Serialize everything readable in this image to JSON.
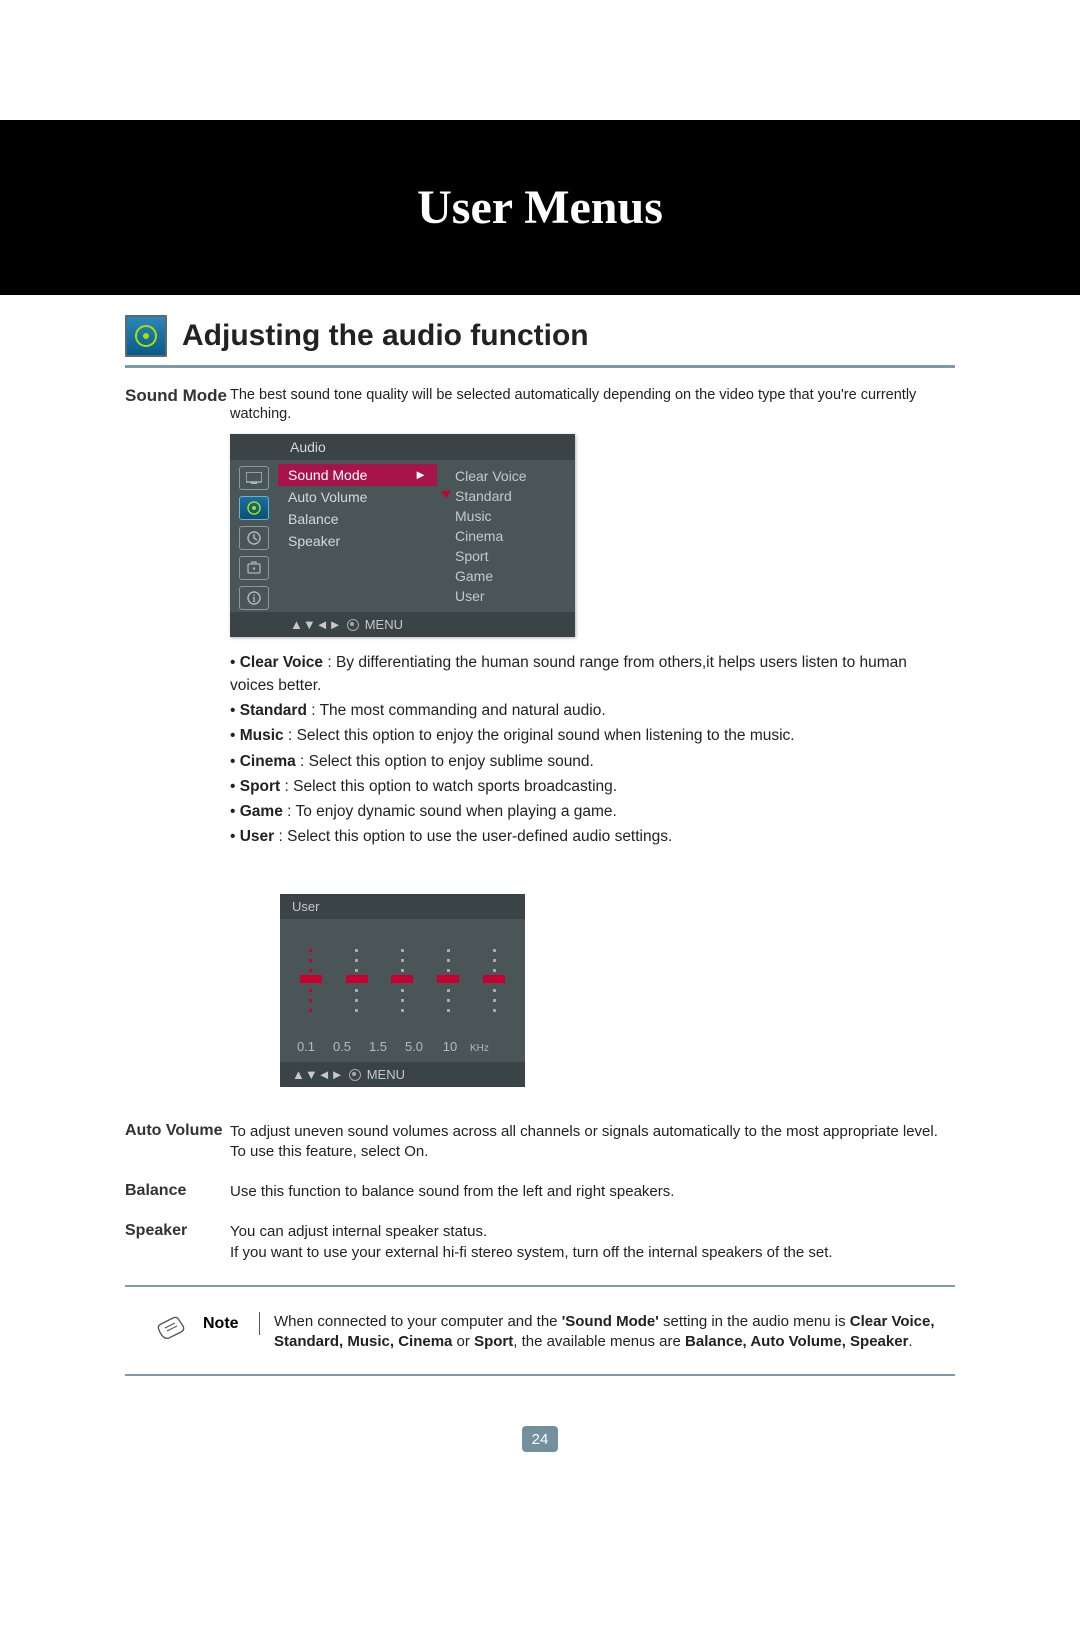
{
  "header": {
    "title": "User Menus"
  },
  "section": {
    "title": "Adjusting the audio function"
  },
  "soundMode": {
    "label": "Sound Mode",
    "intro": "The best sound tone quality will be selected automatically depending on the video type that you're currently watching."
  },
  "osd": {
    "title": "Audio",
    "items": [
      "Sound Mode",
      "Auto Volume",
      "Balance",
      "Speaker"
    ],
    "selectedIndex": 0,
    "sub": [
      "Clear Voice",
      "Standard",
      "Music",
      "Cinema",
      "Sport",
      "Game",
      "User"
    ],
    "subSelectedIndex": 1,
    "footer": "MENU",
    "footerArrows": "▲▼◄►"
  },
  "modeDescriptions": [
    {
      "name": "Clear Voice",
      "text": ": By differentiating the human sound range from others,it helps users listen to human voices better."
    },
    {
      "name": "Standard",
      "text": ": The most commanding and natural audio."
    },
    {
      "name": "Music",
      "text": ": Select this option to enjoy the original sound when listening to the music."
    },
    {
      "name": "Cinema",
      "text": ": Select this option to enjoy sublime sound."
    },
    {
      "name": "Sport",
      "text": ": Select this option to watch sports broadcasting."
    },
    {
      "name": "Game",
      "text": ": To enjoy dynamic sound when playing a game."
    },
    {
      "name": "User",
      "text": ": Select this option to use the user-defined audio settings."
    }
  ],
  "equalizer": {
    "title": "User",
    "bands": [
      "0.1",
      "0.5",
      "1.5",
      "5.0",
      "10"
    ],
    "unit": "KHz",
    "footer": "MENU",
    "footerArrows": "▲▼◄►"
  },
  "defs": {
    "autoVolume": {
      "label": "Auto Volume",
      "text": "To adjust uneven sound volumes across all channels or signals automatically to the most appropriate level. To use this feature, select On."
    },
    "balance": {
      "label": "Balance",
      "text": "Use this function to balance sound from the left and right speakers."
    },
    "speaker": {
      "label": "Speaker",
      "text1": "You can adjust internal speaker status.",
      "text2": "If you want to use your external hi-fi stereo system, turn off the internal speakers of the set."
    }
  },
  "note": {
    "label": "Note",
    "line1a": "When connected to your computer and the ",
    "line1b": "'Sound Mode'",
    "line2a": " setting in the audio menu is  ",
    "line2b": "Clear Voice, Standard, Music, Cinema",
    "line2c": " or ",
    "line2d": "Sport",
    "line2e": ", the available menus are ",
    "line2f": "Balance, Auto Volume, Speaker",
    "line2g": "."
  },
  "pageNumber": "24"
}
